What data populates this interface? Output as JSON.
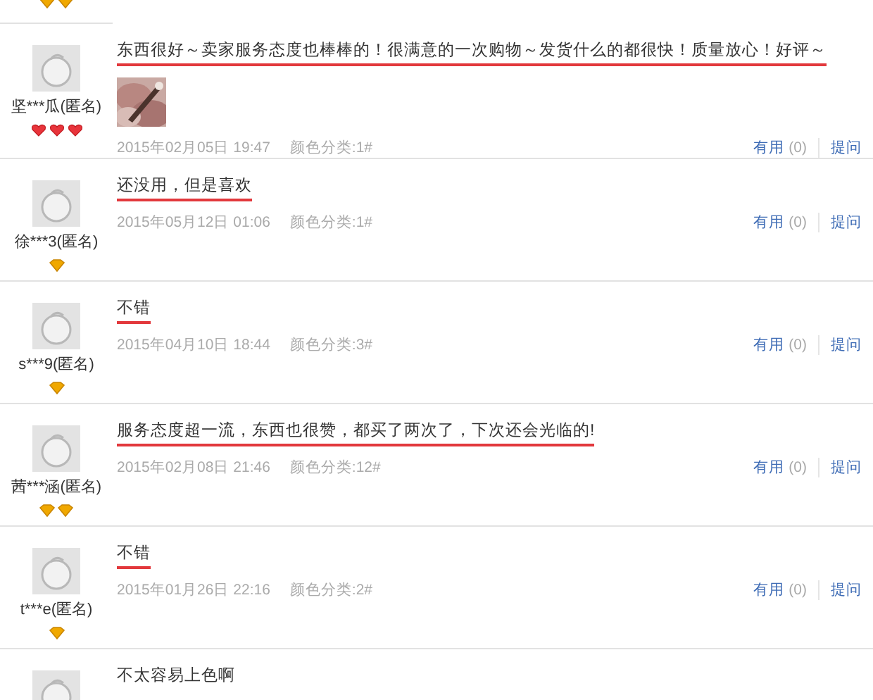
{
  "top_fragment": {
    "badges": [
      {
        "kind": "diamond"
      },
      {
        "kind": "diamond"
      }
    ]
  },
  "reviews": [
    {
      "comment": "东西很好～卖家服务态度也棒棒的！很满意的一次购物～发货什么的都很快！质量放心！好评～",
      "underlined": true,
      "user": "坚***瓜(匿名)",
      "badges": [
        {
          "kind": "heart"
        },
        {
          "kind": "heart"
        },
        {
          "kind": "heart"
        }
      ],
      "date": "2015年02月05日 19:47",
      "variant": "颜色分类:1#",
      "useful_label": "有用",
      "useful_count": "(0)",
      "ask_label": "提问"
    },
    {
      "comment": "还没用，但是喜欢",
      "underlined": true,
      "user": "徐***3(匿名)",
      "badges": [
        {
          "kind": "diamond"
        }
      ],
      "date": "2015年05月12日 01:06",
      "variant": "颜色分类:1#",
      "useful_label": "有用",
      "useful_count": "(0)",
      "ask_label": "提问"
    },
    {
      "comment": "不错",
      "underlined": true,
      "user": "s***9(匿名)",
      "badges": [
        {
          "kind": "diamond"
        }
      ],
      "date": "2015年04月10日 18:44",
      "variant": "颜色分类:3#",
      "useful_label": "有用",
      "useful_count": "(0)",
      "ask_label": "提问"
    },
    {
      "comment": "服务态度超一流，东西也很赞，都买了两次了，下次还会光临的!",
      "underlined": true,
      "user": "茜***涵(匿名)",
      "badges": [
        {
          "kind": "diamond"
        },
        {
          "kind": "diamond"
        }
      ],
      "date": "2015年02月08日 21:46",
      "variant": "颜色分类:12#",
      "useful_label": "有用",
      "useful_count": "(0)",
      "ask_label": "提问"
    },
    {
      "comment": "不错",
      "underlined": true,
      "user": "t***e(匿名)",
      "badges": [
        {
          "kind": "diamond"
        }
      ],
      "date": "2015年01月26日 22:16",
      "variant": "颜色分类:2#",
      "useful_label": "有用",
      "useful_count": "(0)",
      "ask_label": "提问"
    },
    {
      "comment": "不太容易上色啊",
      "underlined": false
    }
  ]
}
